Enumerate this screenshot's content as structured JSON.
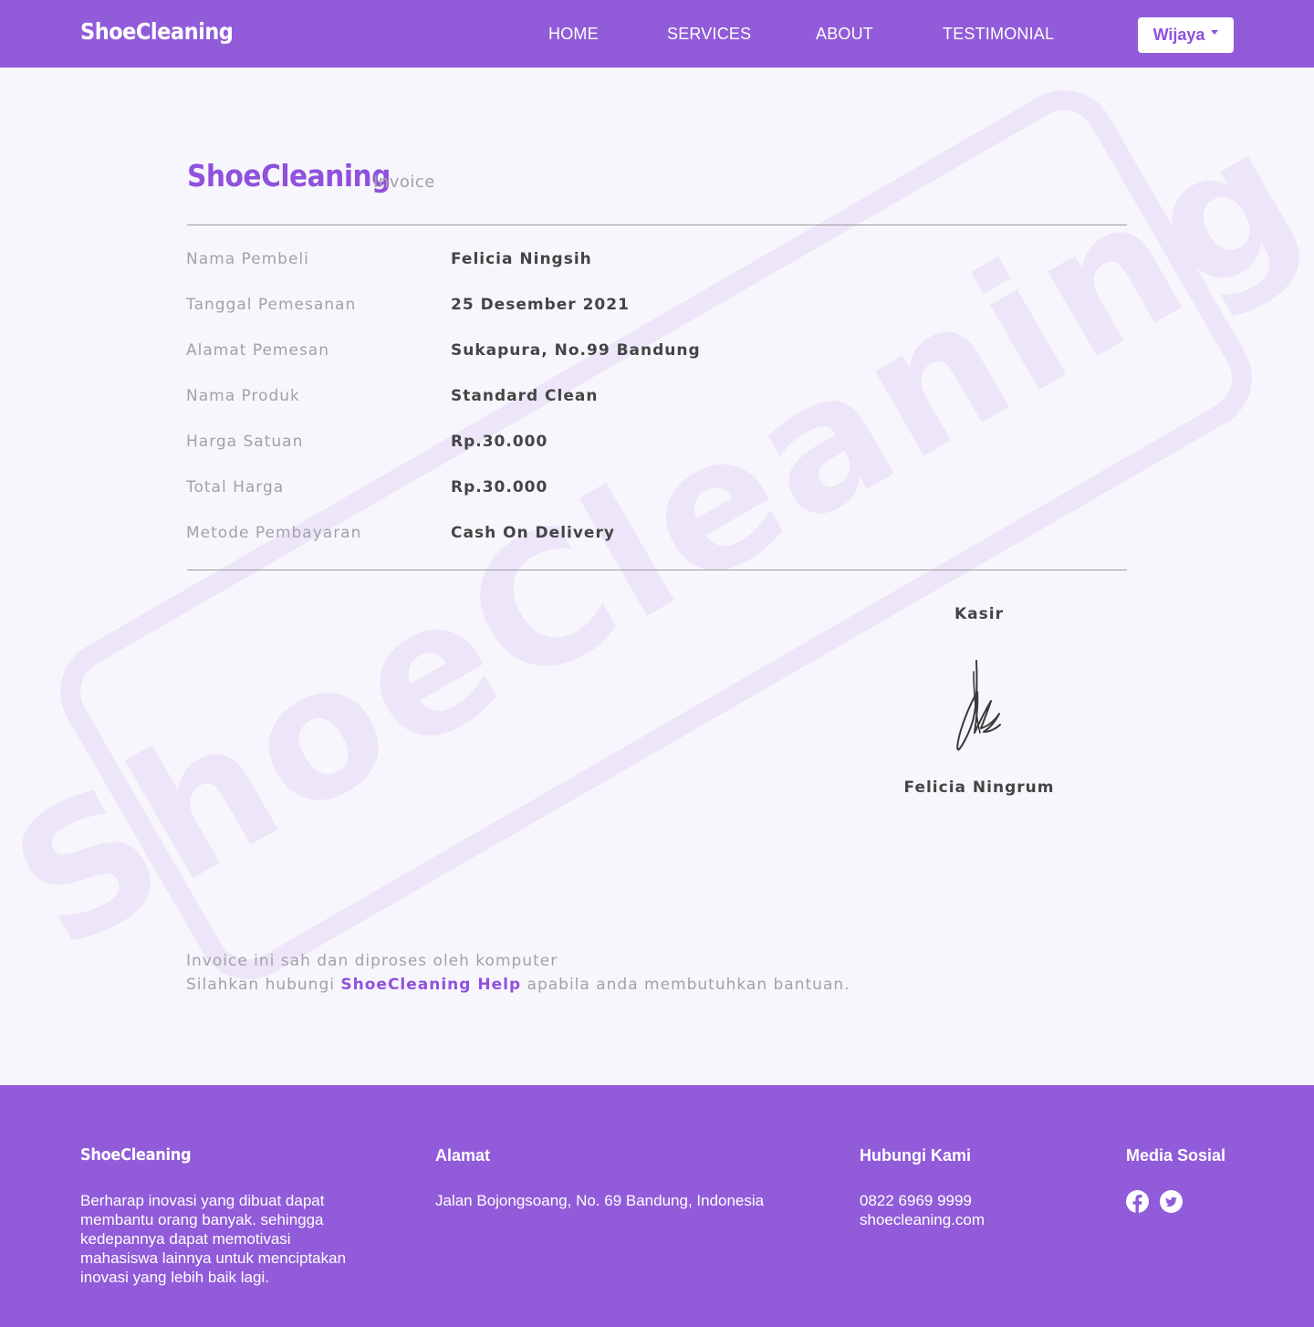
{
  "navbar": {
    "brand": "ShoeCleaning",
    "links": [
      {
        "label": "HOME"
      },
      {
        "label": "SERVICES"
      },
      {
        "label": "ABOUT"
      },
      {
        "label": "TESTIMONIAL"
      }
    ],
    "user": "Wijaya"
  },
  "watermark_text": "ShoeCleaning",
  "invoice": {
    "brand": "ShoeCleaning",
    "subtitle": "Invoice",
    "rows": [
      {
        "label": "Nama Pembeli",
        "value": "Felicia Ningsih"
      },
      {
        "label": "Tanggal Pemesanan",
        "value": "25 Desember 2021"
      },
      {
        "label": "Alamat Pemesan",
        "value": "Sukapura, No.99 Bandung"
      },
      {
        "label": "Nama Produk",
        "value": "Standard Clean"
      },
      {
        "label": "Harga Satuan",
        "value": "Rp.30.000"
      },
      {
        "label": "Total Harga",
        "value": "Rp.30.000"
      },
      {
        "label": "Metode Pembayaran",
        "value": "Cash On Delivery"
      }
    ],
    "cashier_title": "Kasir",
    "cashier_name": "Felicia Ningrum",
    "note_line1": "Invoice ini sah dan diproses oleh komputer",
    "note_line2_prefix": "Silahkan hubungi ",
    "note_link": "ShoeCleaning Help",
    "note_line2_suffix": " apabila anda membutuhkan bantuan."
  },
  "footer": {
    "brand": "ShoeCleaning",
    "tagline_lines": [
      "Berharap inovasi yang dibuat dapat",
      "membantu orang banyak. sehingga",
      "kedepannya dapat memotivasi",
      "mahasiswa lainnya untuk menciptakan",
      "inovasi yang lebih baik lagi."
    ],
    "address_title": "Alamat",
    "address": "Jalan Bojongsoang, No. 69 Bandung, Indonesia",
    "contact_title": "Hubungi Kami",
    "phone": "0822 6969 9999",
    "website": "shoecleaning.com",
    "social_title": "Media Sosial",
    "social_icons": [
      "facebook-icon",
      "twitter-icon"
    ]
  },
  "colors": {
    "primary": "#915bd9",
    "accent_text": "#8f52dc",
    "background": "#f8f6fd",
    "muted_text": "#a3a1a8",
    "body_text": "#444444"
  }
}
